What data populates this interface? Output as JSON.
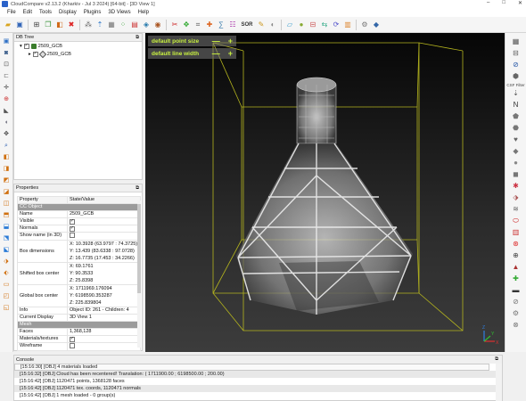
{
  "window": {
    "title": "CloudCompare v2.13.2 (Kharkiv - Jul 3 2024) [64-bit] - [3D View 1]",
    "controls": [
      "–",
      "□",
      "✕"
    ]
  },
  "menu": [
    "File",
    "Edit",
    "Tools",
    "Display",
    "Plugins",
    "3D Views",
    "Help"
  ],
  "toolbar": {
    "sor_label": "SOR",
    "icons": [
      "open-icon",
      "save-icon",
      "global-shift-icon",
      "clone-icon",
      "merge-icon",
      "delete-icon",
      "sample-points-icon",
      "normals-icon",
      "octree-icon",
      "subsample-icon",
      "scalar-field-icon",
      "cloud-cloud-distance-icon",
      "cloud-mesh-distance-icon",
      "segment-icon",
      "translate-rotate-icon",
      "crop-icon",
      "pick-points-icon",
      "compute-icon",
      "point-list-icon",
      "noise-filter-icon",
      "label-icon",
      "hide-icon",
      "plane-icon",
      "sphere-icon",
      "section-icon",
      "register-icon",
      "icp-icon",
      "histogram-icon",
      "plugins-icon",
      "python-icon"
    ]
  },
  "dbtree": {
    "title": "DB Tree",
    "items": [
      {
        "label": "2509_GCB",
        "type": "group",
        "checked": "✓"
      },
      {
        "label": "2509_GCB",
        "type": "mesh",
        "checked": "✓"
      }
    ]
  },
  "properties": {
    "title": "Properties",
    "headers": [
      "Property",
      "State/Value"
    ],
    "section_ccobject": "CC Object",
    "section_mesh": "Mesh",
    "rows": {
      "name": {
        "k": "Name",
        "v": "2509_GCB"
      },
      "visible": {
        "k": "Visible",
        "v": "✓"
      },
      "normals": {
        "k": "Normals",
        "v": "✓"
      },
      "show_name": {
        "k": "Show name (in 3D)",
        "v": ""
      },
      "box_dim": {
        "k": "Box dimensions",
        "x": "X: 10.3928 (63.9797 : 74.3725)",
        "y": "Y: 13.439 (83.6338 : 97.0728)",
        "z": "Z: 16.7735 (17.453 : 34.2266)"
      },
      "shifted": {
        "k": "Shifted box center",
        "x": "X: 69.1761",
        "y": "Y: 90.3533",
        "z": "Z: 25.8398"
      },
      "global": {
        "k": "Global box center",
        "x": "X: 1711969.176094",
        "y": "Y: 6198590.353287",
        "z": "Z: 225.839804"
      },
      "info": {
        "k": "Info",
        "v": "Object ID: 261 - Children: 4"
      },
      "display": {
        "k": "Current Display",
        "v": "3D View 1"
      },
      "faces": {
        "k": "Faces",
        "v": "1,368,128"
      },
      "materials": {
        "k": "Materials/textures",
        "v": "✓"
      },
      "wireframe": {
        "k": "Wireframe",
        "v": ""
      }
    }
  },
  "viewport": {
    "overlay_point": "default point size",
    "overlay_line": "default line width",
    "minus": "—",
    "plus": "+",
    "axis_x": "X",
    "axis_y": "Y",
    "axis_z": "Z",
    "bbox_color": "#b4b41e",
    "overlay_text_color": "#c8f040"
  },
  "righttb": {
    "csf_label": "CSF Filter"
  },
  "console": {
    "title": "Console",
    "lines": [
      "[15:16:30] [OBJ] 4 materials loaded",
      "[15:16:32] [OBJ] Cloud has been recentered! Translation: ( 1711900.00 ;  6198500.00 ;  200.00)",
      "[15:16:42] [OBJ] 1120471 points, 1368128 faces",
      "[15:16:42] [OBJ] 1120471 tex. coords, 1120471 normals",
      "[15:16:42] [OBJ] 1 mesh loaded - 0 group(s)"
    ]
  }
}
